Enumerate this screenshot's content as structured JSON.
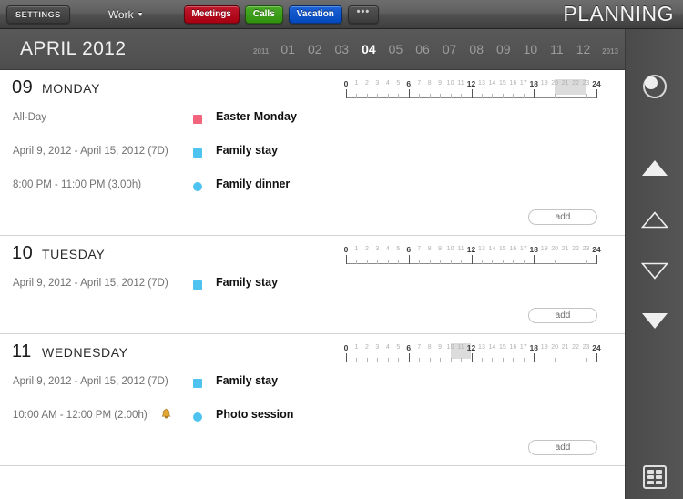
{
  "topbar": {
    "settings_label": "SETTINGS",
    "profile_label": "Work",
    "profile_caret": "▼",
    "categories": [
      {
        "label": "Meetings",
        "color": "#c0182b"
      },
      {
        "label": "Calls",
        "color": "#4aab28"
      },
      {
        "label": "Vacation",
        "color": "#1d62d6"
      }
    ],
    "more_label": "•••",
    "app_title": "PLANNING"
  },
  "monthbar": {
    "title": "APRIL 2012",
    "prev_year": "2011",
    "next_year": "2013",
    "months": [
      "01",
      "02",
      "03",
      "04",
      "05",
      "06",
      "07",
      "08",
      "09",
      "10",
      "11",
      "12"
    ],
    "active_month": "04"
  },
  "ruler": {
    "labels": [
      "0",
      "1",
      "2",
      "3",
      "4",
      "5",
      "6",
      "7",
      "8",
      "9",
      "10",
      "11",
      "12",
      "13",
      "14",
      "15",
      "16",
      "17",
      "18",
      "19",
      "20",
      "21",
      "22",
      "23",
      "24"
    ],
    "major": [
      "0",
      "6",
      "12",
      "18",
      "24"
    ],
    "min_hour": 0,
    "max_hour": 24
  },
  "add_label": "add",
  "days": [
    {
      "number": "09",
      "weekday": "MONDAY",
      "band": {
        "start": 20,
        "end": 23
      },
      "events": [
        {
          "time": "All-Day",
          "title": "Easter Monday",
          "chip": "square",
          "color": "#f2647b",
          "alarm": false
        },
        {
          "time": "April 9, 2012 - April 15, 2012 (7D)",
          "title": "Family stay",
          "chip": "square",
          "color": "#4ec3f0",
          "alarm": false
        },
        {
          "time": "8:00 PM - 11:00 PM (3.00h)",
          "title": "Family dinner",
          "chip": "circle",
          "color": "#4ec3f0",
          "alarm": false
        }
      ]
    },
    {
      "number": "10",
      "weekday": "TUESDAY",
      "band": null,
      "events": [
        {
          "time": "April 9, 2012 - April 15, 2012 (7D)",
          "title": "Family stay",
          "chip": "square",
          "color": "#4ec3f0",
          "alarm": false
        }
      ]
    },
    {
      "number": "11",
      "weekday": "WEDNESDAY",
      "band": {
        "start": 10,
        "end": 12
      },
      "events": [
        {
          "time": "April 9, 2012 - April 15, 2012 (7D)",
          "title": "Family stay",
          "chip": "square",
          "color": "#4ec3f0",
          "alarm": false
        },
        {
          "time": "10:00 AM - 12:00 PM (2.00h)",
          "title": "Photo session",
          "chip": "circle",
          "color": "#4ec3f0",
          "alarm": true
        }
      ]
    }
  ],
  "rail": {
    "today_icon": "circle-today-icon",
    "page_up_icon": "triangle-up-filled-icon",
    "step_up_icon": "triangle-up-outline-icon",
    "step_down_icon": "triangle-down-outline-icon",
    "page_down_icon": "triangle-down-filled-icon",
    "grid_icon": "grid-view-icon"
  }
}
